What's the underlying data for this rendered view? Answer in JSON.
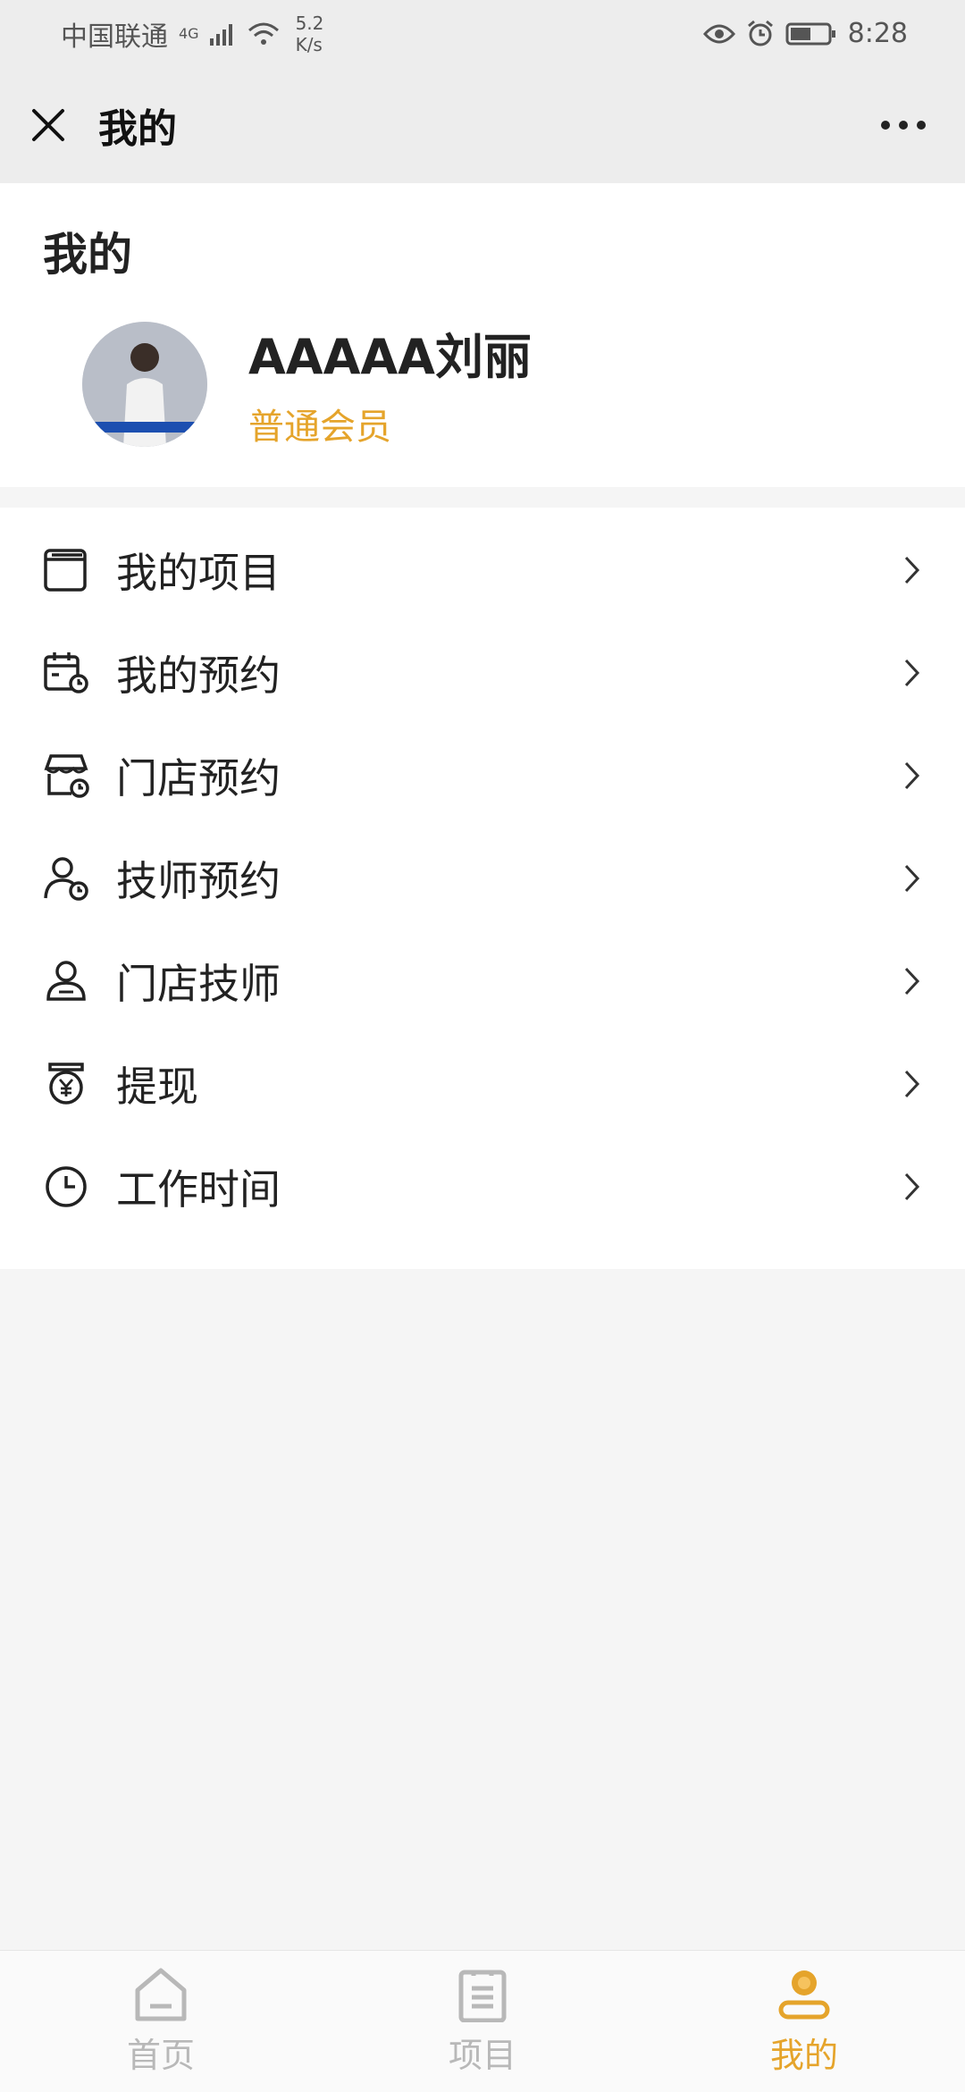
{
  "status_bar": {
    "carrier": "中国联通",
    "network": "4G",
    "speed_value": "5.2",
    "speed_unit": "K/s",
    "time": "8:28"
  },
  "header": {
    "title": "我的"
  },
  "profile": {
    "section_title": "我的",
    "username": "AAAAA刘丽",
    "member_level": "普通会员"
  },
  "menu": {
    "items": [
      {
        "label": "我的项目",
        "icon": "project-window-icon"
      },
      {
        "label": "我的预约",
        "icon": "calendar-clock-icon"
      },
      {
        "label": "门店预约",
        "icon": "store-clock-icon"
      },
      {
        "label": "技师预约",
        "icon": "person-clock-icon"
      },
      {
        "label": "门店技师",
        "icon": "technician-icon"
      },
      {
        "label": "提现",
        "icon": "yen-bag-icon"
      },
      {
        "label": "工作时间",
        "icon": "clock-icon"
      }
    ]
  },
  "tabbar": {
    "tabs": [
      {
        "label": "首页",
        "icon": "home-icon",
        "active": false
      },
      {
        "label": "项目",
        "icon": "clipboard-icon",
        "active": false
      },
      {
        "label": "我的",
        "icon": "user-icon",
        "active": true
      }
    ]
  },
  "colors": {
    "accent": "#e5a42b",
    "inactive": "#b8b8b8",
    "header_bg": "#ededed"
  }
}
